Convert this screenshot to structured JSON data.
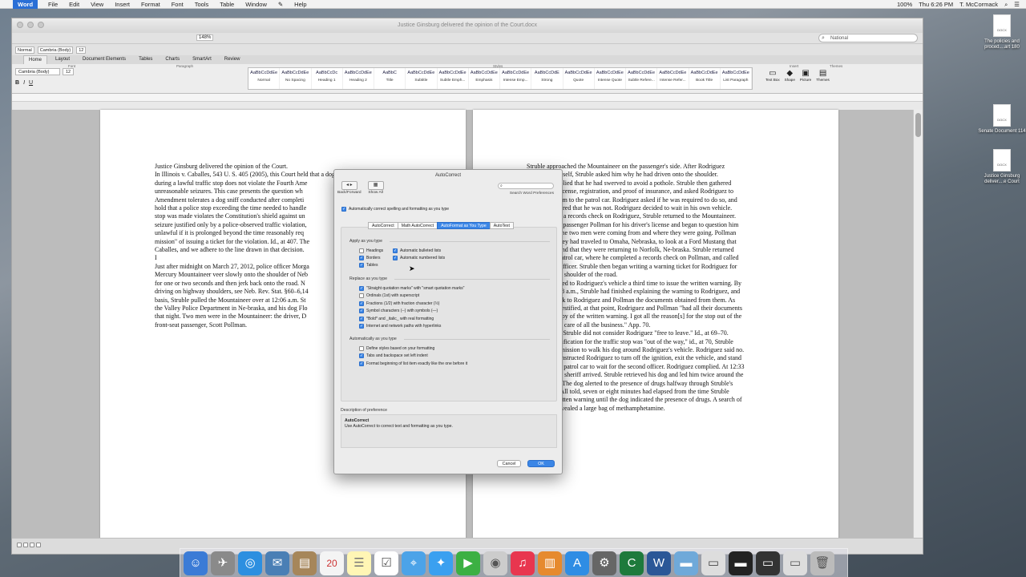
{
  "menubar": {
    "app": "Word",
    "items": [
      "File",
      "Edit",
      "View",
      "Insert",
      "Format",
      "Font",
      "Tools",
      "Table",
      "Window",
      "Help"
    ],
    "clock": "Thu 6:26 PM",
    "user": "T. McCormack",
    "battery": "100%"
  },
  "window": {
    "title": "Justice Ginsburg delivered the opinion of the Court.docx",
    "search_value": "National",
    "zoom": "148%"
  },
  "ribbon": {
    "tabs": [
      "Home",
      "Layout",
      "Document Elements",
      "Tables",
      "Charts",
      "SmartArt",
      "Review"
    ],
    "font": "Cambria (Body)",
    "size": "12",
    "groups": {
      "font": "Font",
      "paragraph": "Paragraph",
      "styles": "Styles",
      "insert": "Insert",
      "themes": "Themes"
    },
    "styles": [
      {
        "sample": "AaBbCcDdEe",
        "name": "Normal"
      },
      {
        "sample": "AaBbCcDdEe",
        "name": "No Spacing"
      },
      {
        "sample": "AaBbCcDc",
        "name": "Heading 1"
      },
      {
        "sample": "AaBbCcDdEe",
        "name": "Heading 2"
      },
      {
        "sample": "AaBbC",
        "name": "Title"
      },
      {
        "sample": "AaBbCcDdEe",
        "name": "Subtitle"
      },
      {
        "sample": "AaBbCcDdEe",
        "name": "Subtle Emph..."
      },
      {
        "sample": "AaBbCcDdEe",
        "name": "Emphasis"
      },
      {
        "sample": "AaBbCcDdEe",
        "name": "Intense Emp..."
      },
      {
        "sample": "AaBbCcDdE",
        "name": "Strong"
      },
      {
        "sample": "AaBbCcDdEe",
        "name": "Quote"
      },
      {
        "sample": "AaBbCcDdEe",
        "name": "Intense Quote"
      },
      {
        "sample": "AaBbCcDdEe",
        "name": "Subtle Refere..."
      },
      {
        "sample": "AaBbCcDdEe",
        "name": "Intense Refer..."
      },
      {
        "sample": "AaBbCcDdEe",
        "name": "Book Title"
      },
      {
        "sample": "AaBbCcDdEe",
        "name": "List Paragraph"
      }
    ],
    "insert": [
      "Text Box",
      "Shape",
      "Picture",
      "Themes"
    ]
  },
  "page1": {
    "lines": [
      "Justice Ginsburg delivered the opinion of the Court.",
      "In Illinois v. Caballes, 543 U. S. 405 (2005), this Court held that a dog sniff conducted",
      "during a lawful traffic stop does not violate the Fourth Ame",
      "unreasonable seizures. This case presents the question wh",
      "Amendment tolerates a dog sniff conducted after completi",
      "hold that a police stop exceeding the time needed to handle",
      "stop was made violates the Constitution's shield against un",
      "seizure justified only by a police-observed traffic violation,",
      "unlawful if it is prolonged beyond the time reasonably req",
      "mission\" of issuing a ticket for the violation. Id., at 407. The",
      "Caballes, and we adhere to the line drawn in that decision.",
      "I",
      "Just after midnight on March 27, 2012, police officer Morga",
      "Mercury Mountaineer veer slowly onto the shoulder of Neb",
      "for one or two seconds and then jerk back onto the road. N",
      "driving on highway shoulders, see Neb. Rev. Stat. §60–6,14",
      "basis, Struble pulled the Mountaineer over at 12:06 a.m. St",
      "the Valley Police Department in Ne-braska, and his dog Flo",
      "that night. Two men were in the Mountaineer: the driver, D",
      "front-seat passenger, Scott Pollman."
    ]
  },
  "page2": {
    "lines": [
      "Struble approached the Mountaineer on the passenger's side. After Rodriguez",
      "identified himself, Struble asked him why he had driven onto the shoulder.",
      "Rodriguez replied that he had swerved to avoid a pothole. Struble then gathered",
      "Rodriguez's license, registration, and proof of insurance, and asked Rodriguez to",
      "accompany him to the patrol car. Rodriguez asked if he was required to do so, and",
      "Struble answered that he was not. Rodriguez decided to wait in his own vehicle.",
      "After running a records check on Rodriguez, Struble returned to the Mountaineer.",
      "Struble asked passenger Pollman for his driver's license and began to question him",
      "about where the two men were coming from and where they were going. Pollman",
      "replied that they had traveled to Omaha, Nebraska, to look at a Ford Mustang that",
      "was for sale and that they were returning to Norfolk, Ne-braska. Struble returned",
      "again to his patrol car, where he completed a records check on Pollman, and called",
      "for a second officer. Struble then began writing a warning ticket for Rodriguez for",
      "driving on the shoulder of the road.",
      "Struble returned to Rodriguez's vehicle a third time to issue the written warning. By",
      "12:27 or 12:28 a.m., Struble had finished explaining the warning to Rodriguez, and",
      "had given back to Rodriguez and Pollman the documents obtained from them. As",
      "Struble later testified, at that point, Rodriguez and Pollman \"had all their documents",
      "back and a copy of the written warning. I got all the reason[s] for the stop out of the",
      "way[,] ... took care of all the business.\" App. 70.",
      "Nevertheless, Struble did not consider Rodriguez \"free to leave.\" Id., at 69–70.",
      "Although justification for the traffic stop was \"out of the way,\" id., at 70, Struble",
      "asked for permission to walk his dog around Rodriguez's vehicle. Rodriguez said no.",
      "Struble then instructed Rodriguez to turn off the ignition, exit the vehicle, and stand",
      "in front of the patrol car to wait for the second officer. Rodriguez complied. At 12:33",
      "a.m., a deputy sheriff arrived. Struble retrieved his dog and led him twice around the",
      "Mountaineer. The dog alerted to the presence of drugs halfway through Struble's",
      "second pass. All told, seven or eight minutes had elapsed from the time Struble",
      "issued the written warning until the dog indicated the presence of drugs. A search of",
      "the vehicle revealed a large bag of methamphetamine."
    ]
  },
  "dialog": {
    "title": "AutoCorrect",
    "toolbar": {
      "back_forward": "Back/Forward",
      "show_all": "Show All",
      "search_pref": "Search Word Preferences"
    },
    "main_check": "Automatically correct spelling and formatting as you type",
    "tabs": [
      "AutoCorrect",
      "Math AutoCorrect",
      "AutoFormat as You Type",
      "AutoText"
    ],
    "apply_header": "Apply as you type",
    "apply_left": [
      {
        "label": "Headings",
        "checked": false
      },
      {
        "label": "Borders",
        "checked": true
      },
      {
        "label": "Tables",
        "checked": true
      }
    ],
    "apply_right": [
      {
        "label": "Automatic bulleted lists",
        "checked": true
      },
      {
        "label": "Automatic numbered lists",
        "checked": true
      }
    ],
    "replace_header": "Replace as you type",
    "replace": [
      {
        "label": "\"Straight quotation marks\" with \"smart quotation marks\"",
        "checked": true
      },
      {
        "label": "Ordinals (1st) with superscript",
        "checked": false
      },
      {
        "label": "Fractions (1/2) with fraction character (½)",
        "checked": true
      },
      {
        "label": "Symbol characters (--) with symbols (—)",
        "checked": true
      },
      {
        "label": "*Bold* and _italic_ with real formatting",
        "checked": true
      },
      {
        "label": "Internet and network paths with hyperlinks",
        "checked": true
      }
    ],
    "auto_header": "Automatically as you type",
    "auto": [
      {
        "label": "Define styles based on your formatting",
        "checked": false
      },
      {
        "label": "Tabs and backspace set left indent",
        "checked": true
      },
      {
        "label": "Format beginning of list item exactly like the one before it",
        "checked": true
      }
    ],
    "desc_header": "Description of preference",
    "desc_title": "AutoCorrect",
    "desc_text": "Use AutoCorrect to correct text and formatting as you type.",
    "cancel": "Cancel",
    "ok": "OK"
  },
  "desktop": [
    {
      "label": "The policies and proced....art 180"
    },
    {
      "label": "Senate Document 114"
    },
    {
      "label": "Justice Ginsburg deliver....e Court"
    }
  ],
  "dock_date": "20"
}
